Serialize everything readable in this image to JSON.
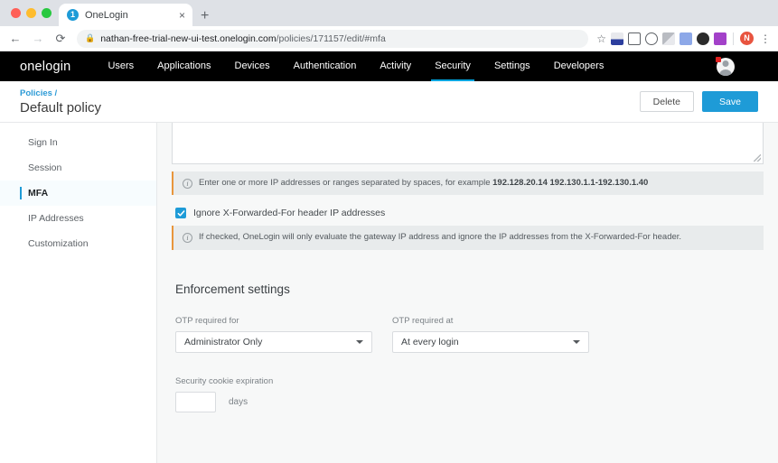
{
  "browser": {
    "tab": {
      "title": "OneLogin",
      "favicon_badge": "1",
      "close_label": "×"
    },
    "new_tab_label": "+",
    "nav": {
      "back": "←",
      "forward": "→",
      "reload": "⟳"
    },
    "address": {
      "lock": "🔒",
      "host": "nathan-free-trial-new-ui-test.onelogin.com",
      "path": "/policies/171157/edit/#mfa"
    },
    "star": "☆",
    "profile_initial": "N",
    "menu": "⋮"
  },
  "topnav": {
    "logo": "onelogin",
    "items": [
      {
        "label": "Users",
        "active": false
      },
      {
        "label": "Applications",
        "active": false
      },
      {
        "label": "Devices",
        "active": false
      },
      {
        "label": "Authentication",
        "active": false
      },
      {
        "label": "Activity",
        "active": false
      },
      {
        "label": "Security",
        "active": true
      },
      {
        "label": "Settings",
        "active": false
      },
      {
        "label": "Developers",
        "active": false
      }
    ],
    "active_accent": "#00a5df"
  },
  "pagehead": {
    "breadcrumb": "Policies /",
    "title": "Default policy",
    "delete_label": "Delete",
    "save_label": "Save",
    "primary_color": "#1e9bd7"
  },
  "sidebar": {
    "items": [
      {
        "label": "Sign In",
        "active": false
      },
      {
        "label": "Session",
        "active": false
      },
      {
        "label": "MFA",
        "active": true
      },
      {
        "label": "IP Addresses",
        "active": false
      },
      {
        "label": "Customization",
        "active": false
      }
    ]
  },
  "main": {
    "ip_textarea_value": "",
    "banner_ip_prefix": "Enter one or more IP addresses or ranges separated by spaces, for example ",
    "banner_ip_examples": "192.128.20.14 192.130.1.1-192.130.1.40",
    "checkbox_label": "Ignore X-Forwarded-For header IP addresses",
    "checkbox_checked": true,
    "banner_xff": "If checked, OneLogin will only evaluate the gateway IP address and ignore the IP addresses from the X-Forwarded-For header.",
    "section_title": "Enforcement settings",
    "otp_required_for": {
      "label": "OTP required for",
      "value": "Administrator Only"
    },
    "otp_required_at": {
      "label": "OTP required at",
      "value": "At every login"
    },
    "cookie": {
      "label": "Security cookie expiration",
      "value": "",
      "unit": "days"
    },
    "banner_accent": "#e8963c"
  }
}
